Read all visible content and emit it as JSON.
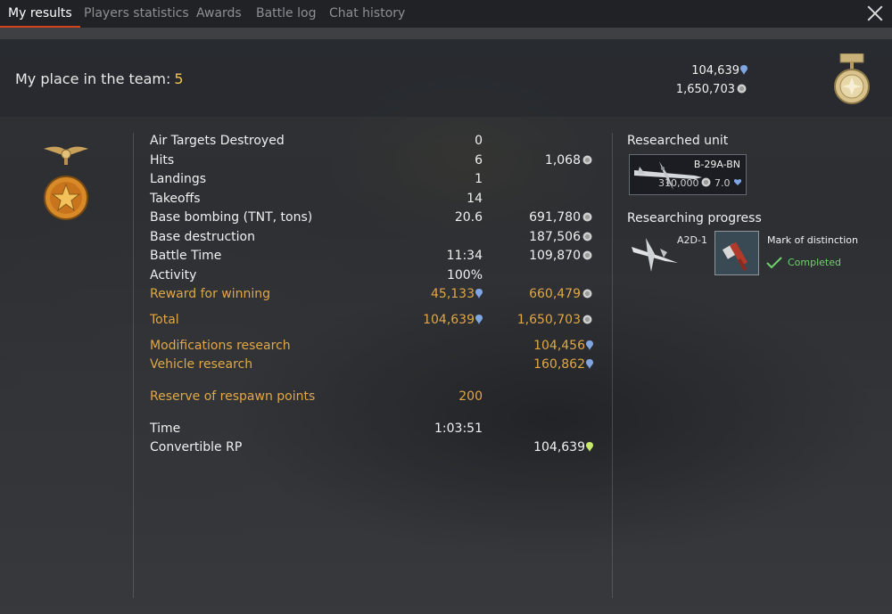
{
  "tabs": [
    {
      "label": "My results"
    },
    {
      "label": "Players statistics"
    },
    {
      "label": "Awards"
    },
    {
      "label": "Battle log"
    },
    {
      "label": "Chat history"
    }
  ],
  "header": {
    "place_label": "My place in the team:",
    "place_value": "5",
    "total_rp": "104,639",
    "total_sl": "1,650,703"
  },
  "stats": [
    {
      "label": "Air Targets Destroyed",
      "value": "0",
      "reward": "",
      "reward_icon": ""
    },
    {
      "label": "Hits",
      "value": "6",
      "reward": "1,068",
      "reward_icon": "sl"
    },
    {
      "label": "Landings",
      "value": "1",
      "reward": "",
      "reward_icon": ""
    },
    {
      "label": "Takeoffs",
      "value": "14",
      "reward": "",
      "reward_icon": ""
    },
    {
      "label": "Base bombing (TNT, tons)",
      "value": "20.6",
      "reward": "691,780",
      "reward_icon": "sl"
    },
    {
      "label": "Base destruction",
      "value": "",
      "reward": "187,506",
      "reward_icon": "sl"
    },
    {
      "label": "Battle Time",
      "value": "11:34",
      "reward": "109,870",
      "reward_icon": "sl"
    },
    {
      "label": "Activity",
      "value": "100%",
      "reward": "",
      "reward_icon": ""
    },
    {
      "label": "Reward for winning",
      "value": "45,133",
      "value_icon": "rp",
      "reward": "660,479",
      "reward_icon": "sl"
    }
  ],
  "total": {
    "label": "Total",
    "rp": "104,639",
    "sl": "1,650,703"
  },
  "modifications_research": {
    "label": "Modifications research",
    "value": "104,456"
  },
  "vehicle_research": {
    "label": "Vehicle research",
    "value": "160,862"
  },
  "reserve": {
    "label": "Reserve of respawn points",
    "value": "200"
  },
  "time": {
    "label": "Time",
    "value": "1:03:51"
  },
  "convertible": {
    "label": "Convertible RP",
    "value": "104,639"
  },
  "researched_unit": {
    "title": "Researched unit",
    "name": "B-29A-BN",
    "cost": "310,000",
    "br": "7.0"
  },
  "researching": {
    "title": "Researching progress",
    "vehicle": "A2D-1",
    "modification": "Mark of distinction",
    "status": "Completed"
  },
  "colors": {
    "accent": "#d2451e",
    "gold": "#e0a746",
    "rp": "#7fa6e0",
    "sl": "#d8d8d8",
    "convertible": "#c7e86a",
    "completed": "#6fd36a"
  }
}
